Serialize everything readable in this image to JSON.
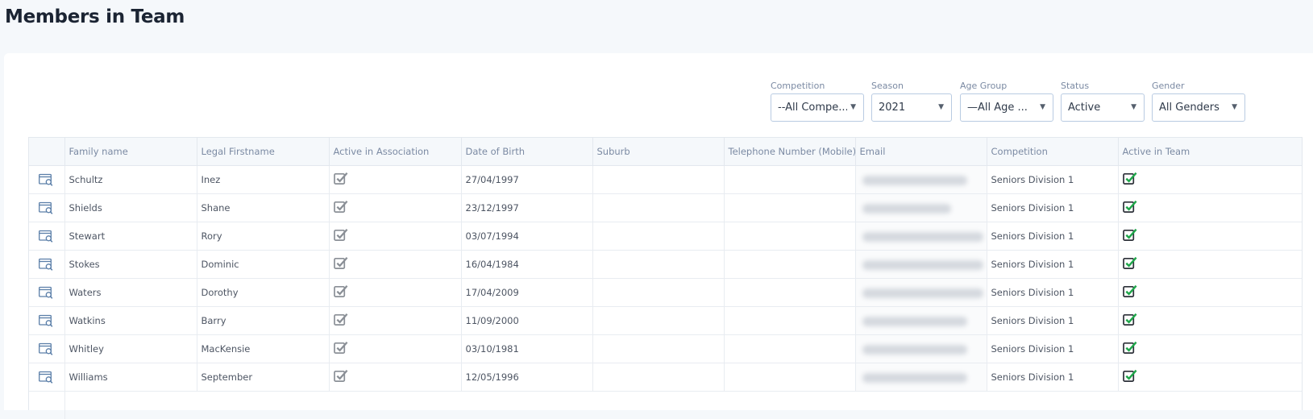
{
  "page": {
    "title": "Members in Team"
  },
  "filters": [
    {
      "label": "Competition",
      "value": "--All Compe...",
      "name": "competition"
    },
    {
      "label": "Season",
      "value": "2021",
      "name": "season"
    },
    {
      "label": "Age Group",
      "value": "—All Age ...",
      "name": "age-group"
    },
    {
      "label": "Status",
      "value": "Active",
      "name": "status"
    },
    {
      "label": "Gender",
      "value": "All Genders",
      "name": "gender"
    }
  ],
  "table": {
    "columns": [
      "",
      "Family name",
      "Legal Firstname",
      "Active in Association",
      "Date of Birth",
      "Suburb",
      "Telephone Number (Mobile)",
      "Email",
      "Competition",
      "Active in Team"
    ],
    "rows": [
      {
        "family": "Schultz",
        "first": "Inez",
        "dob": "27/04/1997",
        "suburb": "",
        "phone": "",
        "competition": "Seniors Division 1"
      },
      {
        "family": "Shields",
        "first": "Shane",
        "dob": "23/12/1997",
        "suburb": "",
        "phone": "",
        "competition": "Seniors Division 1"
      },
      {
        "family": "Stewart",
        "first": "Rory",
        "dob": "03/07/1994",
        "suburb": "",
        "phone": "",
        "competition": "Seniors Division 1"
      },
      {
        "family": "Stokes",
        "first": "Dominic",
        "dob": "16/04/1984",
        "suburb": "",
        "phone": "",
        "competition": "Seniors Division 1"
      },
      {
        "family": "Waters",
        "first": "Dorothy",
        "dob": "17/04/2009",
        "suburb": "",
        "phone": "",
        "competition": "Seniors Division 1"
      },
      {
        "family": "Watkins",
        "first": "Barry",
        "dob": "11/09/2000",
        "suburb": "",
        "phone": "",
        "competition": "Seniors Division 1"
      },
      {
        "family": "Whitley",
        "first": "MacKensie",
        "dob": "03/10/1981",
        "suburb": "",
        "phone": "",
        "competition": "Seniors Division 1"
      },
      {
        "family": "Williams",
        "first": "September",
        "dob": "12/05/1996",
        "suburb": "",
        "phone": "",
        "competition": "Seniors Division 1"
      }
    ]
  },
  "icons": {
    "view": "view-record-icon",
    "active_association": "checkbox-checked-gray-icon",
    "active_team": "checkbox-checked-green-icon"
  },
  "colors": {
    "check_green": "#1fa64a",
    "check_gray": "#8a8f96"
  }
}
